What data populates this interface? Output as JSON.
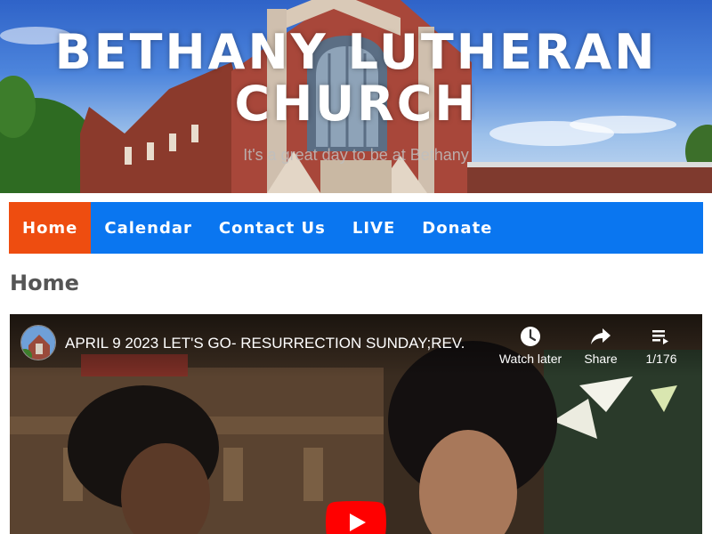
{
  "header": {
    "title_line1": "BETHANY LUTHERAN",
    "title_line2": "CHURCH",
    "tagline": "It's a great day to be at Bethany"
  },
  "nav": {
    "items": [
      {
        "label": "Home",
        "active": true
      },
      {
        "label": "Calendar",
        "active": false
      },
      {
        "label": "Contact Us",
        "active": false
      },
      {
        "label": "LIVE",
        "active": false
      },
      {
        "label": "Donate",
        "active": false
      }
    ]
  },
  "page": {
    "title": "Home"
  },
  "video": {
    "title": "APRIL 9 2023 LET'S GO- RESURRECTION SUNDAY;REV.",
    "watch_later_label": "Watch later",
    "share_label": "Share",
    "playlist_count": "1/176",
    "icons": {
      "watch_later": "clock-icon",
      "share": "share-arrow-icon",
      "playlist": "playlist-icon",
      "play": "play-icon"
    }
  },
  "colors": {
    "nav_bg": "#0a76f0",
    "nav_active": "#ee4d10",
    "page_title": "#555555",
    "play_button": "#ff0000"
  }
}
